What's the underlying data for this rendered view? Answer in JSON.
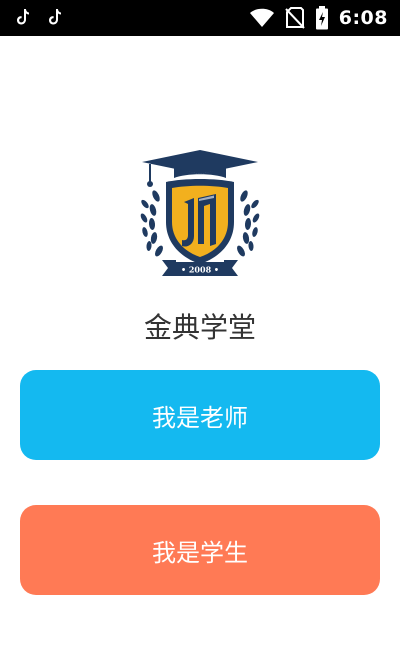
{
  "status_bar": {
    "time": "6:08",
    "icons": [
      "tiktok-icon",
      "tiktok-icon",
      "wifi-icon",
      "no-sim-icon",
      "battery-charging-icon"
    ]
  },
  "logo": {
    "year": "• 2008 •",
    "colors": {
      "navy": "#1f3a60",
      "gold": "#f2b01e"
    }
  },
  "app": {
    "name": "金典学堂"
  },
  "buttons": {
    "teacher": {
      "label": "我是老师",
      "color": "#14b9f0"
    },
    "student": {
      "label": "我是学生",
      "color": "#ff7a55"
    }
  }
}
